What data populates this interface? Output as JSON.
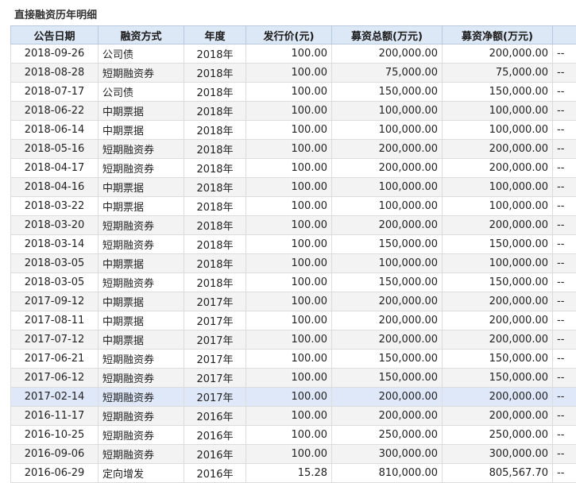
{
  "title": "直接融资历年明细",
  "columns": [
    "公告日期",
    "融资方式",
    "年度",
    "发行价(元)",
    "募资总额(万元)",
    "募资净额(万元)",
    ""
  ],
  "rows": [
    [
      "2018-09-26",
      "公司债",
      "2018年",
      "100.00",
      "200,000.00",
      "200,000.00",
      "--"
    ],
    [
      "2018-08-28",
      "短期融资券",
      "2018年",
      "100.00",
      "75,000.00",
      "75,000.00",
      "--"
    ],
    [
      "2018-07-17",
      "公司债",
      "2018年",
      "100.00",
      "150,000.00",
      "150,000.00",
      "--"
    ],
    [
      "2018-06-22",
      "中期票据",
      "2018年",
      "100.00",
      "100,000.00",
      "100,000.00",
      "--"
    ],
    [
      "2018-06-14",
      "中期票据",
      "2018年",
      "100.00",
      "100,000.00",
      "100,000.00",
      "--"
    ],
    [
      "2018-05-16",
      "短期融资券",
      "2018年",
      "100.00",
      "200,000.00",
      "200,000.00",
      "--"
    ],
    [
      "2018-04-17",
      "短期融资券",
      "2018年",
      "100.00",
      "200,000.00",
      "200,000.00",
      "--"
    ],
    [
      "2018-04-16",
      "中期票据",
      "2018年",
      "100.00",
      "100,000.00",
      "100,000.00",
      "--"
    ],
    [
      "2018-03-22",
      "中期票据",
      "2018年",
      "100.00",
      "100,000.00",
      "100,000.00",
      "--"
    ],
    [
      "2018-03-20",
      "短期融资券",
      "2018年",
      "100.00",
      "200,000.00",
      "200,000.00",
      "--"
    ],
    [
      "2018-03-14",
      "短期融资券",
      "2018年",
      "100.00",
      "150,000.00",
      "150,000.00",
      "--"
    ],
    [
      "2018-03-05",
      "中期票据",
      "2018年",
      "100.00",
      "100,000.00",
      "100,000.00",
      "--"
    ],
    [
      "2018-03-05",
      "短期融资券",
      "2018年",
      "100.00",
      "150,000.00",
      "150,000.00",
      "--"
    ],
    [
      "2017-09-12",
      "中期票据",
      "2017年",
      "100.00",
      "200,000.00",
      "200,000.00",
      "--"
    ],
    [
      "2017-08-11",
      "中期票据",
      "2017年",
      "100.00",
      "200,000.00",
      "200,000.00",
      "--"
    ],
    [
      "2017-07-12",
      "中期票据",
      "2017年",
      "100.00",
      "200,000.00",
      "200,000.00",
      "--"
    ],
    [
      "2017-06-21",
      "短期融资券",
      "2017年",
      "100.00",
      "150,000.00",
      "150,000.00",
      "--"
    ],
    [
      "2017-06-12",
      "短期融资券",
      "2017年",
      "100.00",
      "150,000.00",
      "150,000.00",
      "--"
    ],
    [
      "2017-02-14",
      "短期融资券",
      "2017年",
      "100.00",
      "200,000.00",
      "200,000.00",
      "--"
    ],
    [
      "2016-11-17",
      "短期融资券",
      "2016年",
      "100.00",
      "200,000.00",
      "200,000.00",
      "--"
    ],
    [
      "2016-10-25",
      "短期融资券",
      "2016年",
      "100.00",
      "250,000.00",
      "250,000.00",
      "--"
    ],
    [
      "2016-09-06",
      "短期融资券",
      "2016年",
      "100.00",
      "300,000.00",
      "300,000.00",
      "--"
    ],
    [
      "2016-06-29",
      "定向增发",
      "2016年",
      "15.28",
      "810,000.00",
      "805,567.70",
      "--"
    ]
  ],
  "selected_row": 18
}
